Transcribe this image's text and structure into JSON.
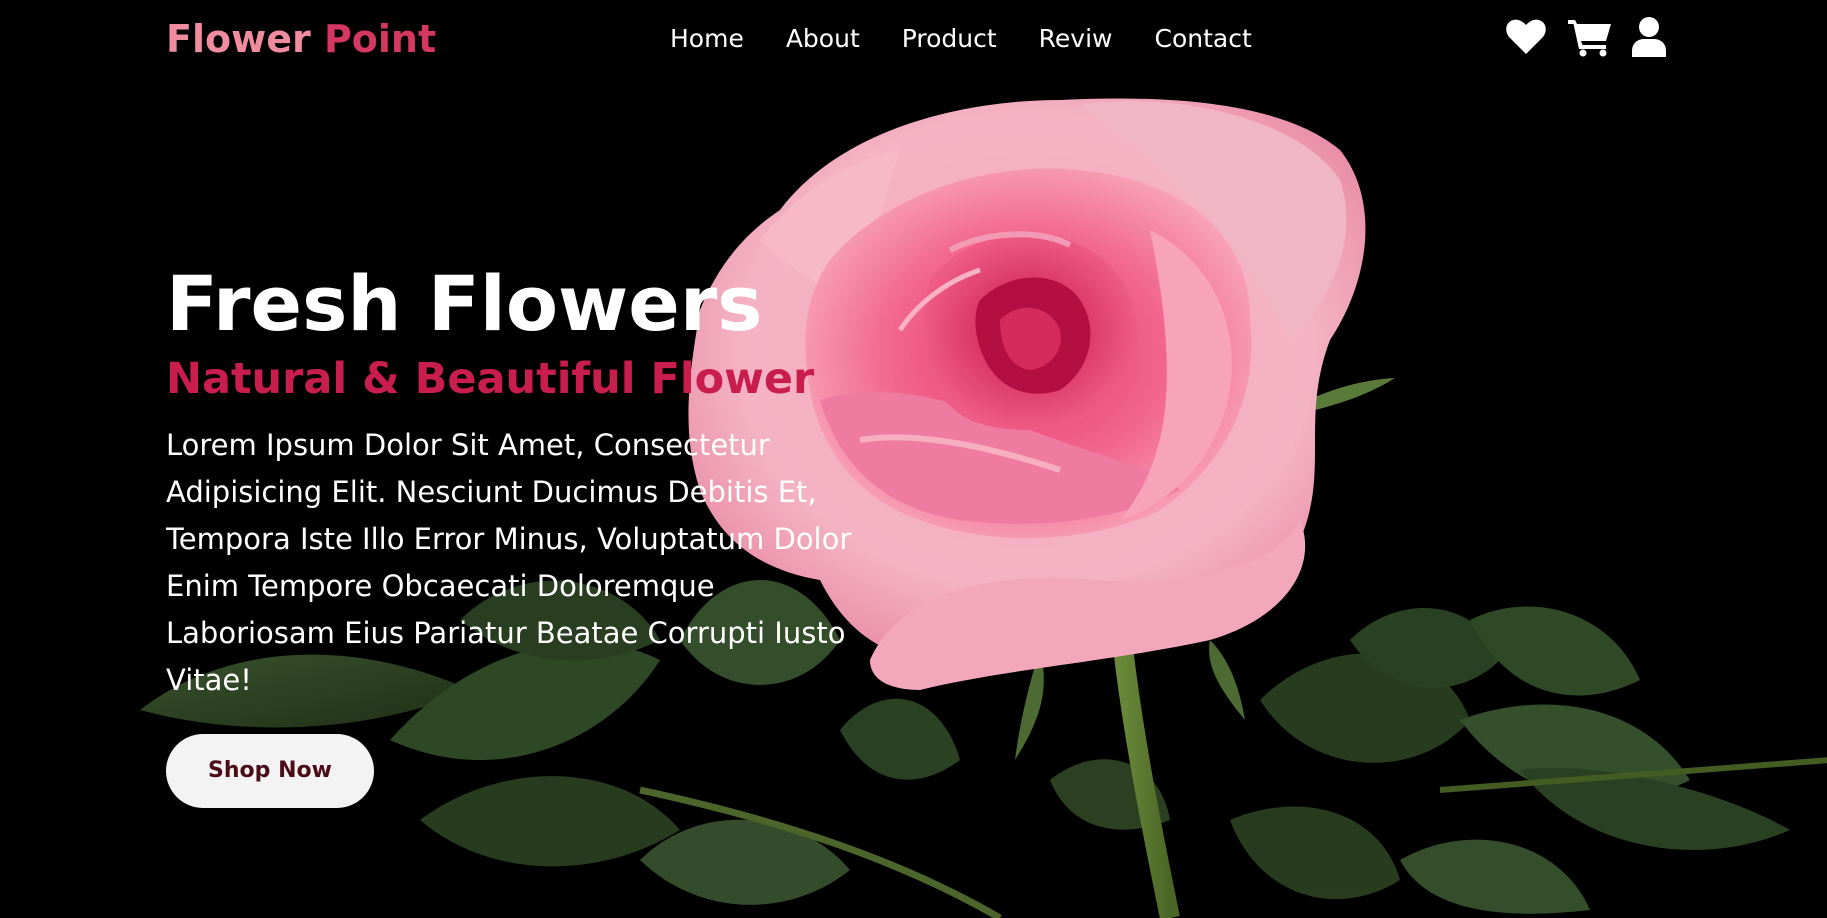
{
  "brand": {
    "part1": "Flower",
    "part2": "Point"
  },
  "nav": {
    "links": [
      "Home",
      "About",
      "Product",
      "Reviw",
      "Contact"
    ]
  },
  "icons": {
    "wishlist": "heart-icon",
    "cart": "cart-icon",
    "account": "user-icon"
  },
  "hero": {
    "title": "Fresh Flowers",
    "subtitle": "Natural & Beautiful Flower",
    "text": "Lorem Ipsum Dolor Sit Amet, Consectetur Adipisicing Elit. Nesciunt Ducimus Debitis Et, Tempora Iste Illo Error Minus, Voluptatum Dolor Enim Tempore Obcaecati Doloremque Laboriosam Eius Pariatur Beatae Corrupti Iusto Vitae!",
    "button_label": "Shop Now"
  },
  "colors": {
    "background": "#000000",
    "logo_light": "#f08ca0",
    "logo_dark": "#d4375f",
    "subtitle": "#c81d4d",
    "button_bg": "#f4f3f3",
    "button_text": "#4a0c18"
  }
}
